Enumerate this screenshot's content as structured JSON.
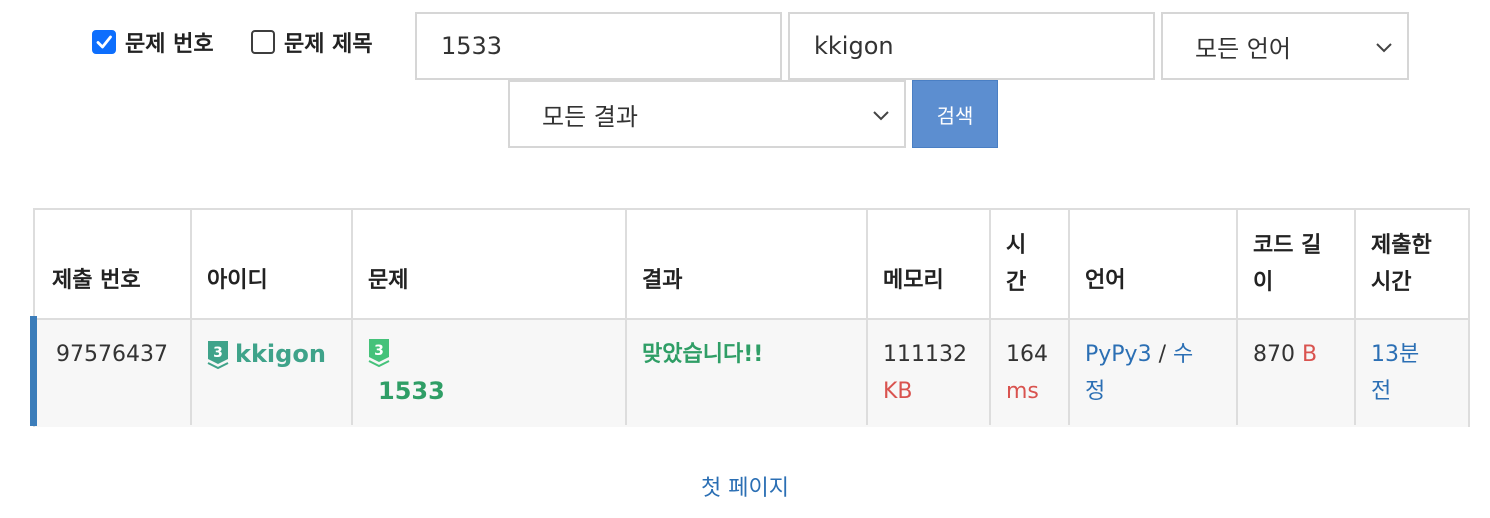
{
  "filters": {
    "checkbox_problem_number": {
      "label": "문제 번호",
      "checked": true
    },
    "checkbox_problem_title": {
      "label": "문제 제목",
      "checked": false
    },
    "problem_input": "1533",
    "user_input": "kkigon",
    "language_select": "모든 언어",
    "result_select": "모든 결과",
    "search_button": "검색"
  },
  "table": {
    "headers": {
      "submission_id": "제출 번호",
      "user_id": "아이디",
      "problem": "문제",
      "result": "결과",
      "memory_1": "메모리",
      "time_1": "시",
      "time_2": "간",
      "language": "언어",
      "code_length_1": "코드 길",
      "code_length_2": "이",
      "submitted_1": "제출한",
      "submitted_2": "시간"
    },
    "rows": [
      {
        "submission_id": "97576437",
        "user_tier": "3",
        "user_id": "kkigon",
        "problem_tier": "3",
        "problem_id": "1533",
        "result": "맞았습니다!!",
        "memory_value": "111132",
        "memory_unit": "KB",
        "time_value": "164",
        "time_unit": "ms",
        "language": "PyPy3",
        "separator": "/",
        "edit_1": "수",
        "edit_2": "정",
        "code_length_value": "870",
        "code_length_unit": "B",
        "submitted_1": "13분",
        "submitted_2": "전"
      }
    ]
  },
  "pagination": {
    "first_page": "첫 페이지"
  },
  "colors": {
    "accent": "#3c7dba",
    "link": "#2b6fb4",
    "success": "#2f9e66",
    "unit_red": "#d9534f",
    "button": "#5c8ed0",
    "tier_badge": "#3fa38a"
  },
  "icons": [
    "checkbox-checked-icon",
    "checkbox-unchecked-icon",
    "chevron-down-icon",
    "tier-badge-icon"
  ]
}
